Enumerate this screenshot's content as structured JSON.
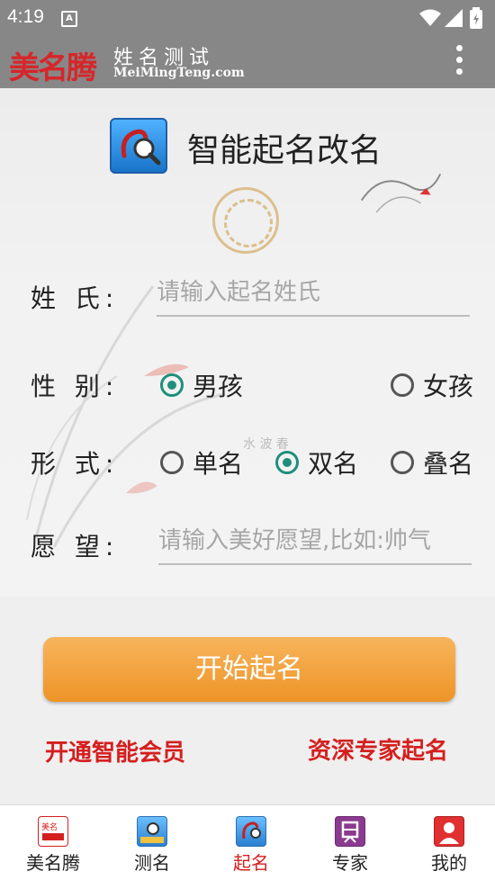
{
  "status": {
    "time": "4:19",
    "note_glyph": "A"
  },
  "header": {
    "logo": "美名腾",
    "slogan": "姓名测试",
    "slogan_sub": "MeiMingTeng.com"
  },
  "page": {
    "title": "智能起名改名"
  },
  "form": {
    "surname": {
      "label": "姓 氏:",
      "placeholder": "请输入起名姓氏",
      "value": ""
    },
    "gender": {
      "label": "性 别:",
      "options": [
        {
          "label": "男孩",
          "checked": true
        },
        {
          "label": "女孩",
          "checked": false
        }
      ]
    },
    "form_type": {
      "label": "形 式:",
      "options": [
        {
          "label": "单名",
          "checked": false
        },
        {
          "label": "双名",
          "checked": true
        },
        {
          "label": "叠名",
          "checked": false
        }
      ]
    },
    "wish": {
      "label": "愿 望:",
      "placeholder": "请输入美好愿望,比如:帅气",
      "value": ""
    }
  },
  "actions": {
    "start": "开始起名",
    "vip_link": "开通智能会员",
    "expert_link": "资深专家起名"
  },
  "colors": {
    "accent": "#ee9427",
    "link": "#d51f1f",
    "radio_checked": "#1e8f7a",
    "header_bg": "#878787"
  },
  "bottom_nav": [
    {
      "label": "美名腾",
      "icon": "meimingteng-logo-icon",
      "active": false
    },
    {
      "label": "测名",
      "icon": "name-test-icon",
      "active": false
    },
    {
      "label": "起名",
      "icon": "naming-icon",
      "active": true
    },
    {
      "label": "专家",
      "icon": "expert-icon",
      "active": false
    },
    {
      "label": "我的",
      "icon": "profile-icon",
      "active": false
    }
  ]
}
